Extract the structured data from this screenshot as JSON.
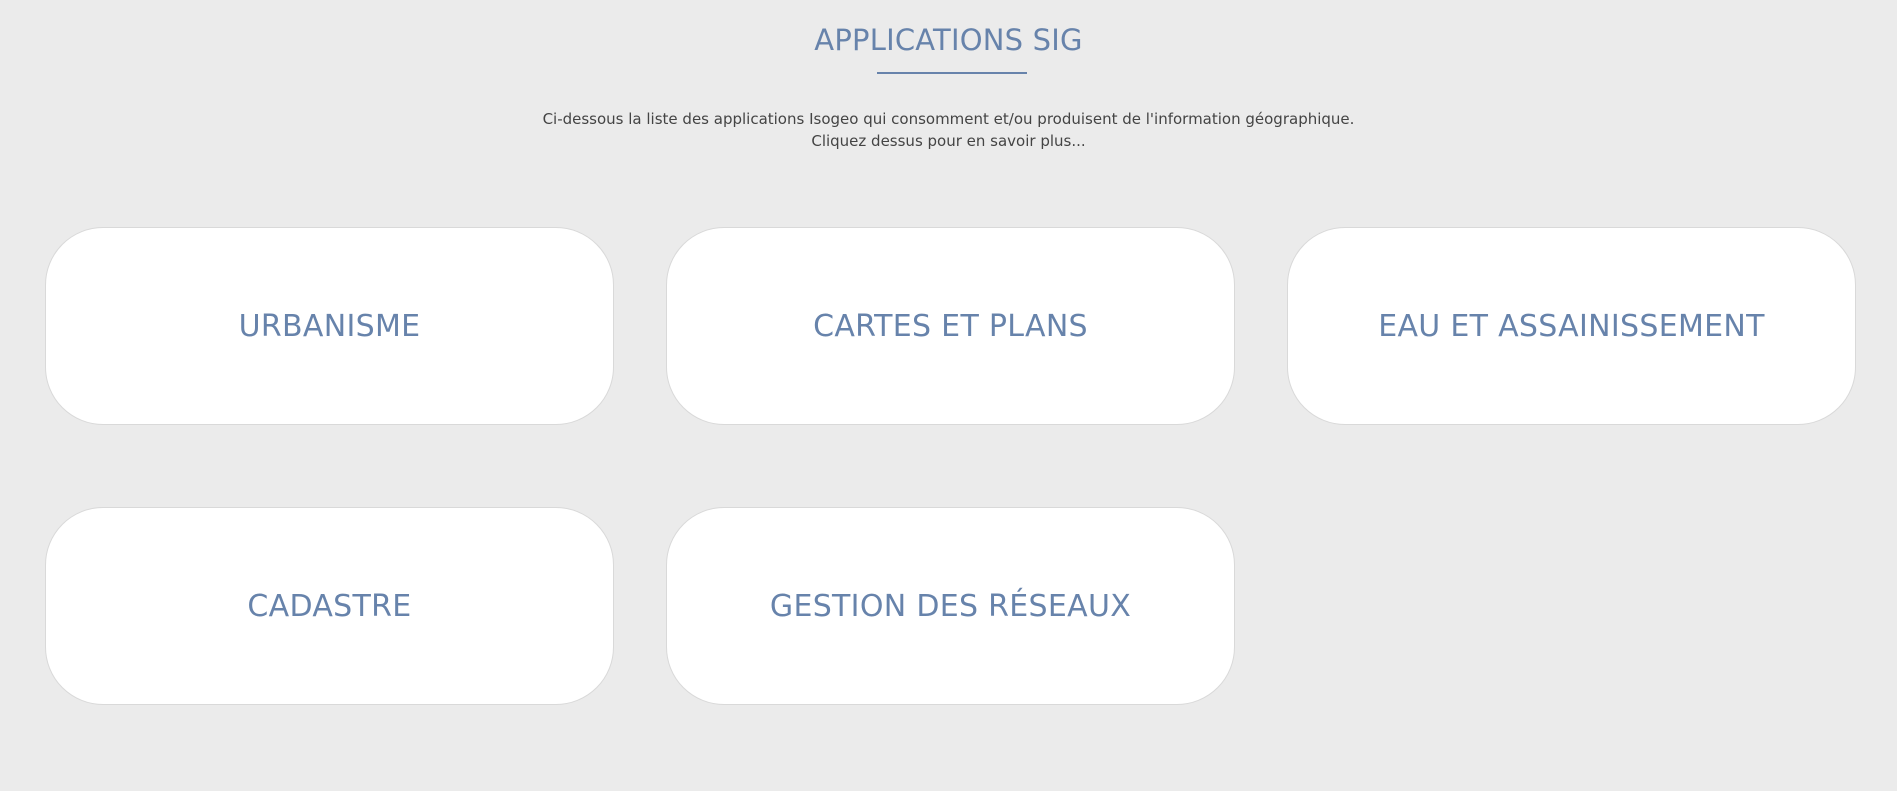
{
  "header": {
    "title": "APPLICATIONS SIG",
    "intro_line1": "Ci-dessous la liste des applications Isogeo qui consomment et/ou produisent de l'information géographique.",
    "intro_line2": "Cliquez dessus pour en savoir plus..."
  },
  "cards": [
    {
      "label": "URBANISME"
    },
    {
      "label": "CARTES ET PLANS"
    },
    {
      "label": "EAU ET ASSAINISSEMENT"
    },
    {
      "label": "CADASTRE"
    },
    {
      "label": "GESTION DES RÉSEAUX"
    }
  ],
  "colors": {
    "accent": "#6783ab",
    "background": "#ebebeb",
    "card": "#ffffff"
  }
}
